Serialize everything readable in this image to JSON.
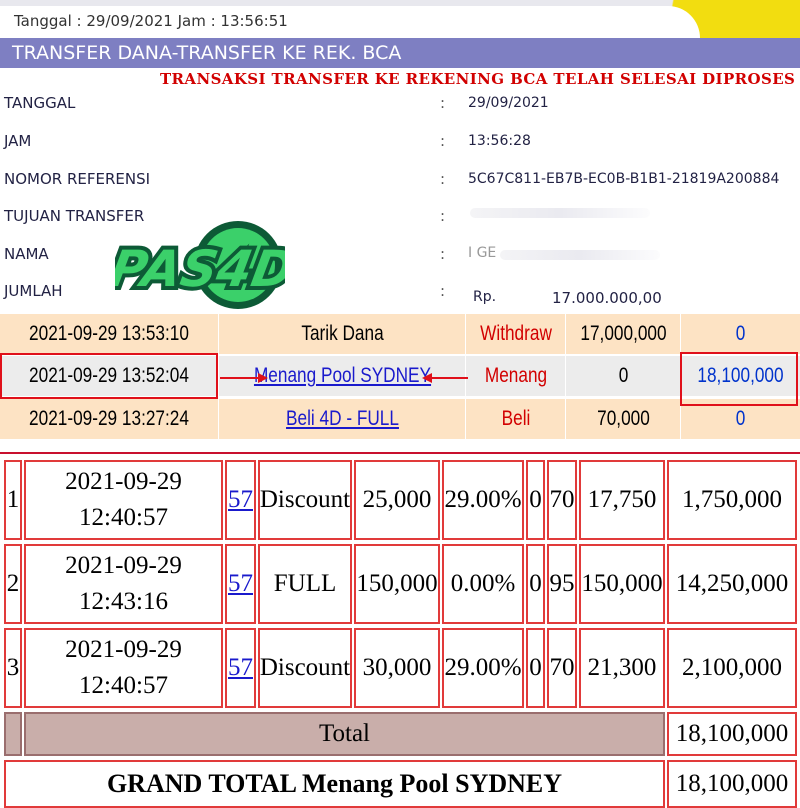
{
  "header": {
    "timestamp": "Tanggal : 29/09/2021 Jam : 13:56:51",
    "title": "TRANSFER DANA-TRANSFER KE REK. BCA",
    "status_message": "TRANSAKSI TRANSFER KE REKENING BCA TELAH SELESAI DIPROSES"
  },
  "details": [
    {
      "label": "TANGGAL",
      "value": "29/09/2021"
    },
    {
      "label": "JAM",
      "value": "13:56:28"
    },
    {
      "label": "NOMOR REFERENSI",
      "value": "5C67C811-EB7B-EC0B-B1B1-21819A200884"
    },
    {
      "label": "TUJUAN TRANSFER",
      "value": ""
    },
    {
      "label": "NAMA",
      "value": "I GE"
    },
    {
      "label": "JUMLAH",
      "currency": "Rp.",
      "value": "17.000.000,00"
    }
  ],
  "colon": ":",
  "logo": {
    "text": "PAS4D",
    "colors": {
      "green": "#3bd06a",
      "dark": "#0d5a36"
    }
  },
  "transactions": [
    {
      "datetime": "2021-09-29 13:53:10",
      "description": "Tarik Dana",
      "type": "Withdraw",
      "debit": "17,000,000",
      "credit": "0"
    },
    {
      "datetime": "2021-09-29 13:52:04",
      "description": "Menang Pool SYDNEY",
      "type": "Menang",
      "debit": "0",
      "credit": "18,100,000"
    },
    {
      "datetime": "2021-09-29 13:27:24",
      "description": "Beli 4D - FULL",
      "type": "Beli",
      "debit": "70,000",
      "credit": "0"
    }
  ],
  "bets": [
    {
      "no": "1",
      "date": "2021-09-29",
      "time": "12:40:57",
      "number": "57",
      "type": "Discount",
      "bet": "25,000",
      "discount_pct": "29.00%",
      "x": "0",
      "mult": "70",
      "paid": "17,750",
      "win": "1,750,000"
    },
    {
      "no": "2",
      "date": "2021-09-29",
      "time": "12:43:16",
      "number": "57",
      "type": "FULL",
      "bet": "150,000",
      "discount_pct": "0.00%",
      "x": "0",
      "mult": "95",
      "paid": "150,000",
      "win": "14,250,000"
    },
    {
      "no": "3",
      "date": "2021-09-29",
      "time": "12:40:57",
      "number": "57",
      "type": "Discount",
      "bet": "30,000",
      "discount_pct": "29.00%",
      "x": "0",
      "mult": "70",
      "paid": "21,300",
      "win": "2,100,000"
    }
  ],
  "total": {
    "label": "Total",
    "value": "18,100,000"
  },
  "grand_total": {
    "label": "GRAND TOTAL  Menang Pool SYDNEY",
    "value": "18,100,000"
  },
  "colors": {
    "title_bar": "#7e7fc2",
    "accent_red": "#d10000",
    "highlight": "#e0101a",
    "link_blue": "#1a1acc",
    "row_orange": "#fde3c4",
    "total_row": "#c9aeaa"
  }
}
